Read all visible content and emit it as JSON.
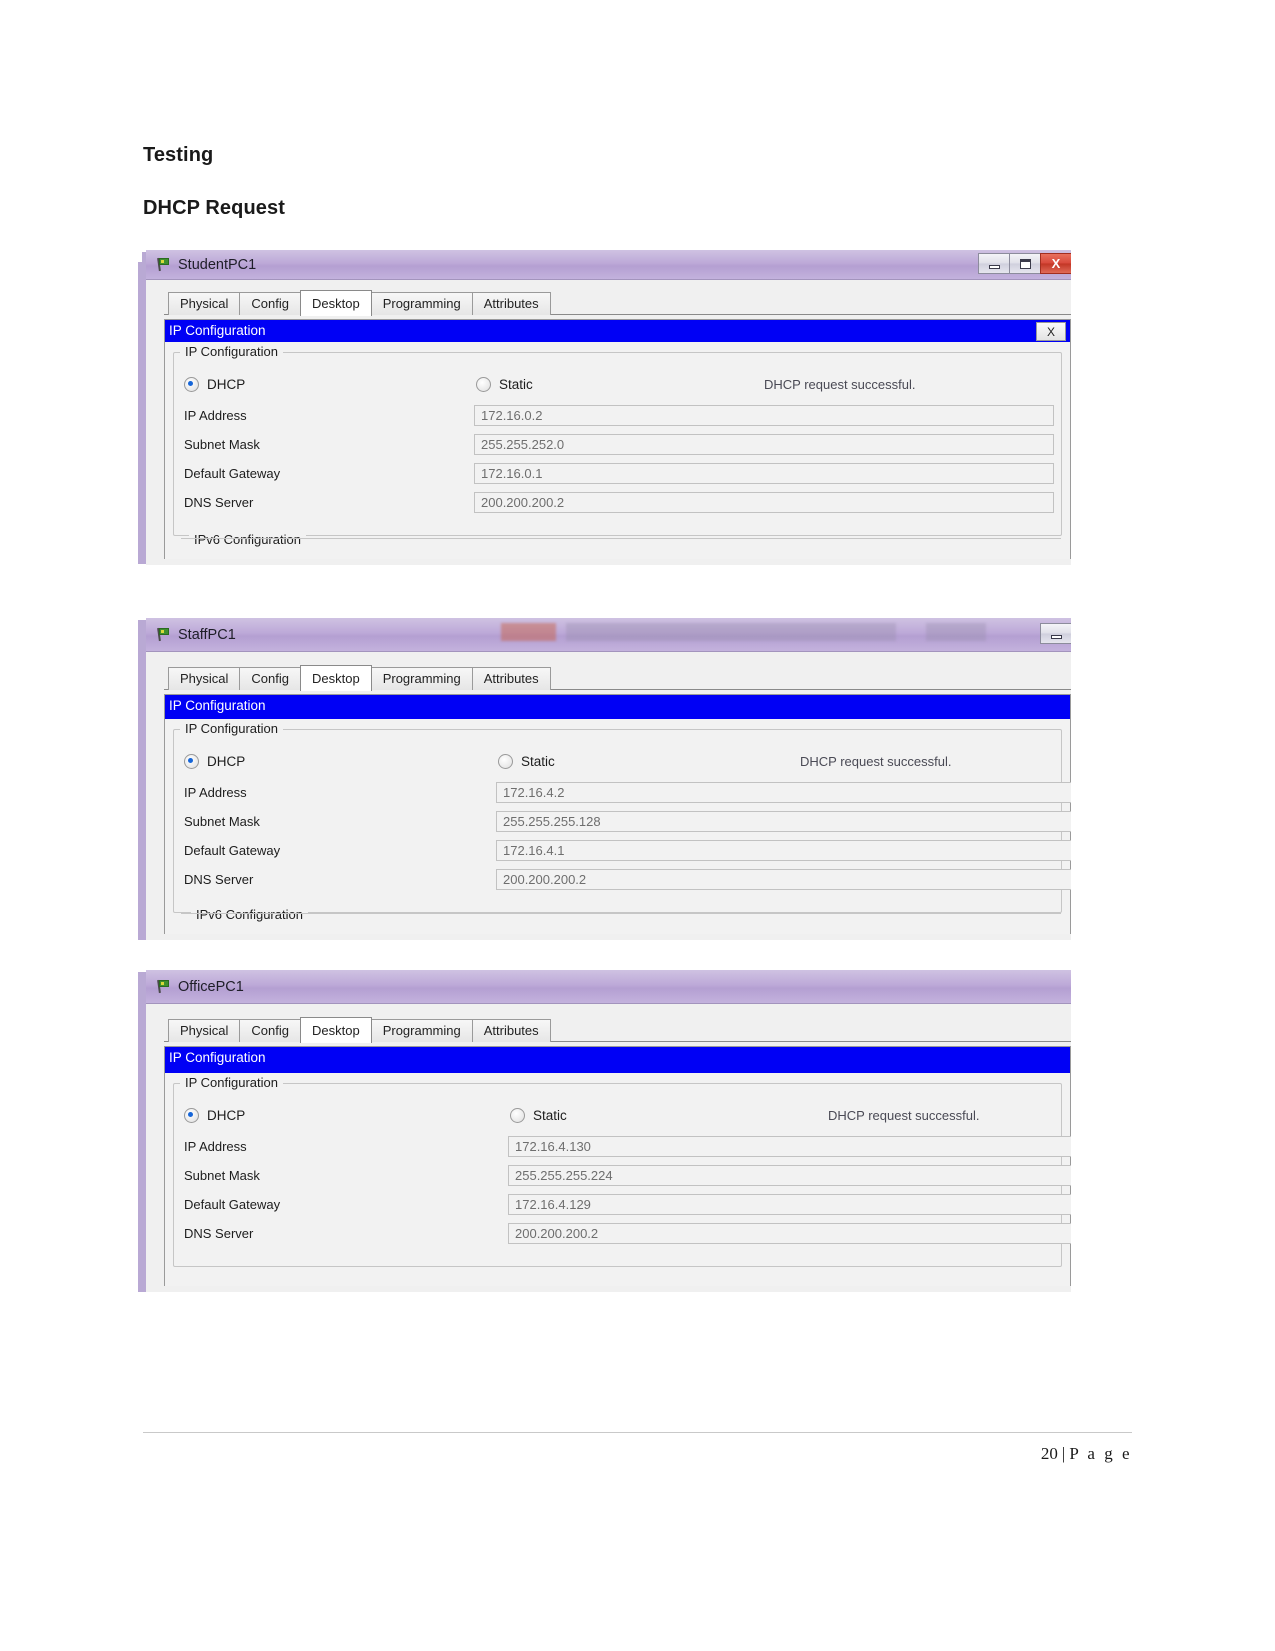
{
  "document": {
    "heading_testing": "Testing",
    "heading_dhcp": "DHCP Request",
    "footer_page_number": "20",
    "footer_separator": "|",
    "footer_page_word": "P a g e"
  },
  "common": {
    "tabs": [
      "Physical",
      "Config",
      "Desktop",
      "Programming",
      "Attributes"
    ],
    "active_tab": "Desktop",
    "panel_title": "IP Configuration",
    "panel_close_label": "X",
    "group_legend": "IP Configuration",
    "ipv6_legend": "IPv6 Configuration",
    "dhcp_label": "DHCP",
    "static_label": "Static",
    "status_message": "DHCP request successful.",
    "field_labels": {
      "ip_address": "IP Address",
      "subnet_mask": "Subnet Mask",
      "default_gateway": "Default Gateway",
      "dns_server": "DNS Server"
    },
    "window_buttons": {
      "minimize": "minimize-button",
      "maximize": "maximize-button",
      "close": "X"
    },
    "accent_blue": "#0000f5",
    "titlebar_purple": "#b49fd2",
    "close_red": "#d8483a"
  },
  "windows": [
    {
      "title": "StudentPC1",
      "selected_mode": "DHCP",
      "status": "DHCP request successful.",
      "ip_address": "172.16.0.2",
      "subnet_mask": "255.255.252.0",
      "default_gateway": "172.16.0.1",
      "dns_server": "200.200.200.2"
    },
    {
      "title": "StaffPC1",
      "selected_mode": "DHCP",
      "status": "DHCP request successful.",
      "ip_address": "172.16.4.2",
      "subnet_mask": "255.255.255.128",
      "default_gateway": "172.16.4.1",
      "dns_server": "200.200.200.2"
    },
    {
      "title": "OfficePC1",
      "selected_mode": "DHCP",
      "status": "DHCP request successful.",
      "ip_address": "172.16.4.130",
      "subnet_mask": "255.255.255.224",
      "default_gateway": "172.16.4.129",
      "dns_server": "200.200.200.2"
    }
  ]
}
